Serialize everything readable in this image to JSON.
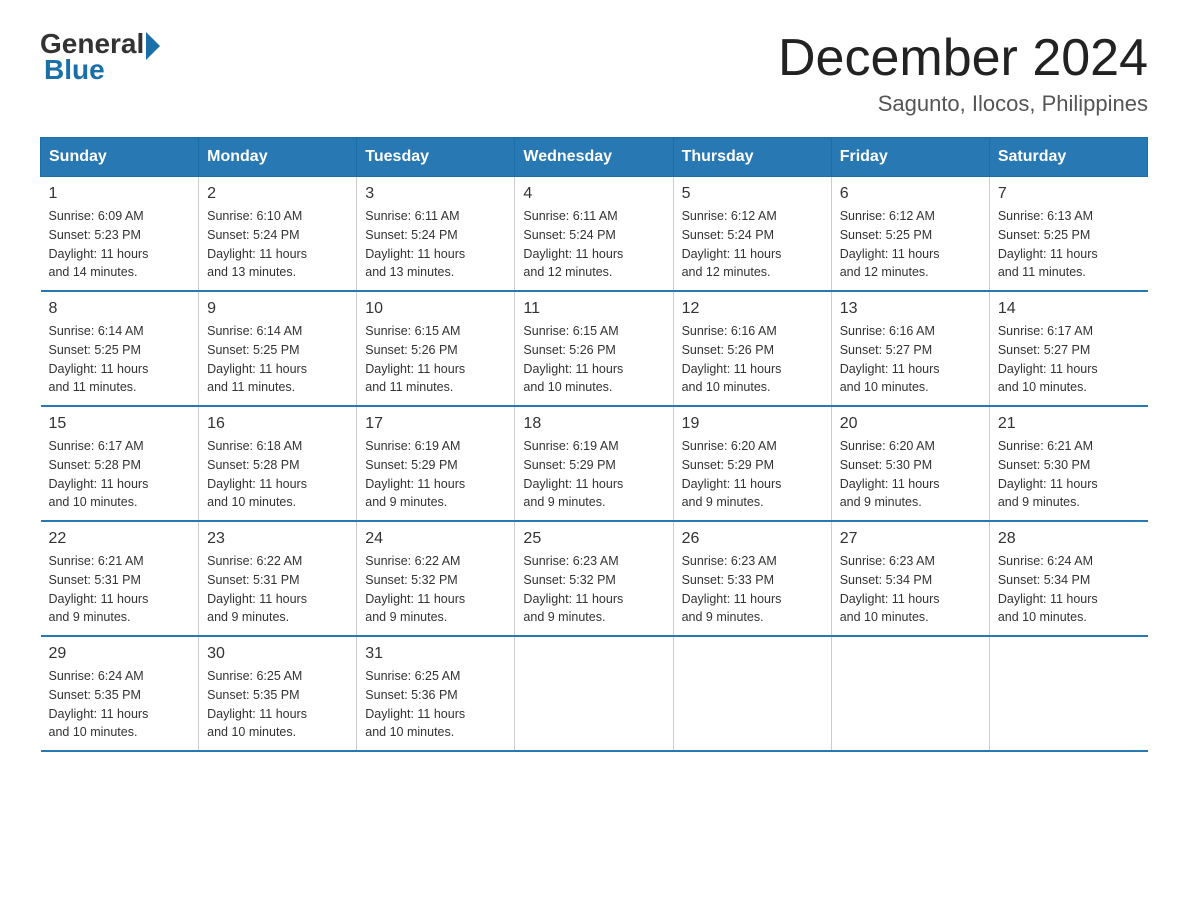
{
  "header": {
    "logo_general": "General",
    "logo_blue": "Blue",
    "month_year": "December 2024",
    "location": "Sagunto, Ilocos, Philippines"
  },
  "days_of_week": [
    "Sunday",
    "Monday",
    "Tuesday",
    "Wednesday",
    "Thursday",
    "Friday",
    "Saturday"
  ],
  "weeks": [
    [
      {
        "day": "1",
        "info": "Sunrise: 6:09 AM\nSunset: 5:23 PM\nDaylight: 11 hours\nand 14 minutes."
      },
      {
        "day": "2",
        "info": "Sunrise: 6:10 AM\nSunset: 5:24 PM\nDaylight: 11 hours\nand 13 minutes."
      },
      {
        "day": "3",
        "info": "Sunrise: 6:11 AM\nSunset: 5:24 PM\nDaylight: 11 hours\nand 13 minutes."
      },
      {
        "day": "4",
        "info": "Sunrise: 6:11 AM\nSunset: 5:24 PM\nDaylight: 11 hours\nand 12 minutes."
      },
      {
        "day": "5",
        "info": "Sunrise: 6:12 AM\nSunset: 5:24 PM\nDaylight: 11 hours\nand 12 minutes."
      },
      {
        "day": "6",
        "info": "Sunrise: 6:12 AM\nSunset: 5:25 PM\nDaylight: 11 hours\nand 12 minutes."
      },
      {
        "day": "7",
        "info": "Sunrise: 6:13 AM\nSunset: 5:25 PM\nDaylight: 11 hours\nand 11 minutes."
      }
    ],
    [
      {
        "day": "8",
        "info": "Sunrise: 6:14 AM\nSunset: 5:25 PM\nDaylight: 11 hours\nand 11 minutes."
      },
      {
        "day": "9",
        "info": "Sunrise: 6:14 AM\nSunset: 5:25 PM\nDaylight: 11 hours\nand 11 minutes."
      },
      {
        "day": "10",
        "info": "Sunrise: 6:15 AM\nSunset: 5:26 PM\nDaylight: 11 hours\nand 11 minutes."
      },
      {
        "day": "11",
        "info": "Sunrise: 6:15 AM\nSunset: 5:26 PM\nDaylight: 11 hours\nand 10 minutes."
      },
      {
        "day": "12",
        "info": "Sunrise: 6:16 AM\nSunset: 5:26 PM\nDaylight: 11 hours\nand 10 minutes."
      },
      {
        "day": "13",
        "info": "Sunrise: 6:16 AM\nSunset: 5:27 PM\nDaylight: 11 hours\nand 10 minutes."
      },
      {
        "day": "14",
        "info": "Sunrise: 6:17 AM\nSunset: 5:27 PM\nDaylight: 11 hours\nand 10 minutes."
      }
    ],
    [
      {
        "day": "15",
        "info": "Sunrise: 6:17 AM\nSunset: 5:28 PM\nDaylight: 11 hours\nand 10 minutes."
      },
      {
        "day": "16",
        "info": "Sunrise: 6:18 AM\nSunset: 5:28 PM\nDaylight: 11 hours\nand 10 minutes."
      },
      {
        "day": "17",
        "info": "Sunrise: 6:19 AM\nSunset: 5:29 PM\nDaylight: 11 hours\nand 9 minutes."
      },
      {
        "day": "18",
        "info": "Sunrise: 6:19 AM\nSunset: 5:29 PM\nDaylight: 11 hours\nand 9 minutes."
      },
      {
        "day": "19",
        "info": "Sunrise: 6:20 AM\nSunset: 5:29 PM\nDaylight: 11 hours\nand 9 minutes."
      },
      {
        "day": "20",
        "info": "Sunrise: 6:20 AM\nSunset: 5:30 PM\nDaylight: 11 hours\nand 9 minutes."
      },
      {
        "day": "21",
        "info": "Sunrise: 6:21 AM\nSunset: 5:30 PM\nDaylight: 11 hours\nand 9 minutes."
      }
    ],
    [
      {
        "day": "22",
        "info": "Sunrise: 6:21 AM\nSunset: 5:31 PM\nDaylight: 11 hours\nand 9 minutes."
      },
      {
        "day": "23",
        "info": "Sunrise: 6:22 AM\nSunset: 5:31 PM\nDaylight: 11 hours\nand 9 minutes."
      },
      {
        "day": "24",
        "info": "Sunrise: 6:22 AM\nSunset: 5:32 PM\nDaylight: 11 hours\nand 9 minutes."
      },
      {
        "day": "25",
        "info": "Sunrise: 6:23 AM\nSunset: 5:32 PM\nDaylight: 11 hours\nand 9 minutes."
      },
      {
        "day": "26",
        "info": "Sunrise: 6:23 AM\nSunset: 5:33 PM\nDaylight: 11 hours\nand 9 minutes."
      },
      {
        "day": "27",
        "info": "Sunrise: 6:23 AM\nSunset: 5:34 PM\nDaylight: 11 hours\nand 10 minutes."
      },
      {
        "day": "28",
        "info": "Sunrise: 6:24 AM\nSunset: 5:34 PM\nDaylight: 11 hours\nand 10 minutes."
      }
    ],
    [
      {
        "day": "29",
        "info": "Sunrise: 6:24 AM\nSunset: 5:35 PM\nDaylight: 11 hours\nand 10 minutes."
      },
      {
        "day": "30",
        "info": "Sunrise: 6:25 AM\nSunset: 5:35 PM\nDaylight: 11 hours\nand 10 minutes."
      },
      {
        "day": "31",
        "info": "Sunrise: 6:25 AM\nSunset: 5:36 PM\nDaylight: 11 hours\nand 10 minutes."
      },
      {
        "day": "",
        "info": ""
      },
      {
        "day": "",
        "info": ""
      },
      {
        "day": "",
        "info": ""
      },
      {
        "day": "",
        "info": ""
      }
    ]
  ]
}
